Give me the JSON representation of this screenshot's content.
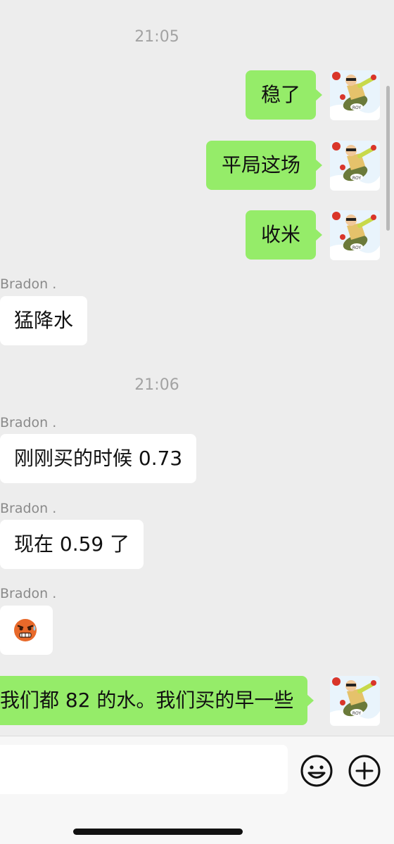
{
  "chat": {
    "timestamps": [
      "21:05",
      "21:06"
    ],
    "sent": [
      {
        "text": "稳了"
      },
      {
        "text": "平局这场"
      },
      {
        "text": "收米"
      },
      {
        "text": "我们都 82 的水。我们买的早一些"
      }
    ],
    "received": [
      {
        "sender": "Bradon .",
        "text": "猛降水"
      },
      {
        "sender": "Bradon .",
        "text": "刚刚买的时候 0.73"
      },
      {
        "sender": "Bradon .",
        "text": "现在 0.59 了"
      },
      {
        "sender": "Bradon .",
        "sticker": "grimacing-face-sticker"
      }
    ],
    "avatar": {
      "badge_text": "ROY"
    }
  },
  "input": {
    "placeholder": ""
  },
  "icons": {
    "emoji": "smiley-face-icon",
    "more": "plus-circle-icon"
  },
  "colors": {
    "background": "#ededed",
    "sent_bubble": "#95ec69",
    "received_bubble": "#ffffff",
    "timestamp": "#a3a3a3"
  }
}
